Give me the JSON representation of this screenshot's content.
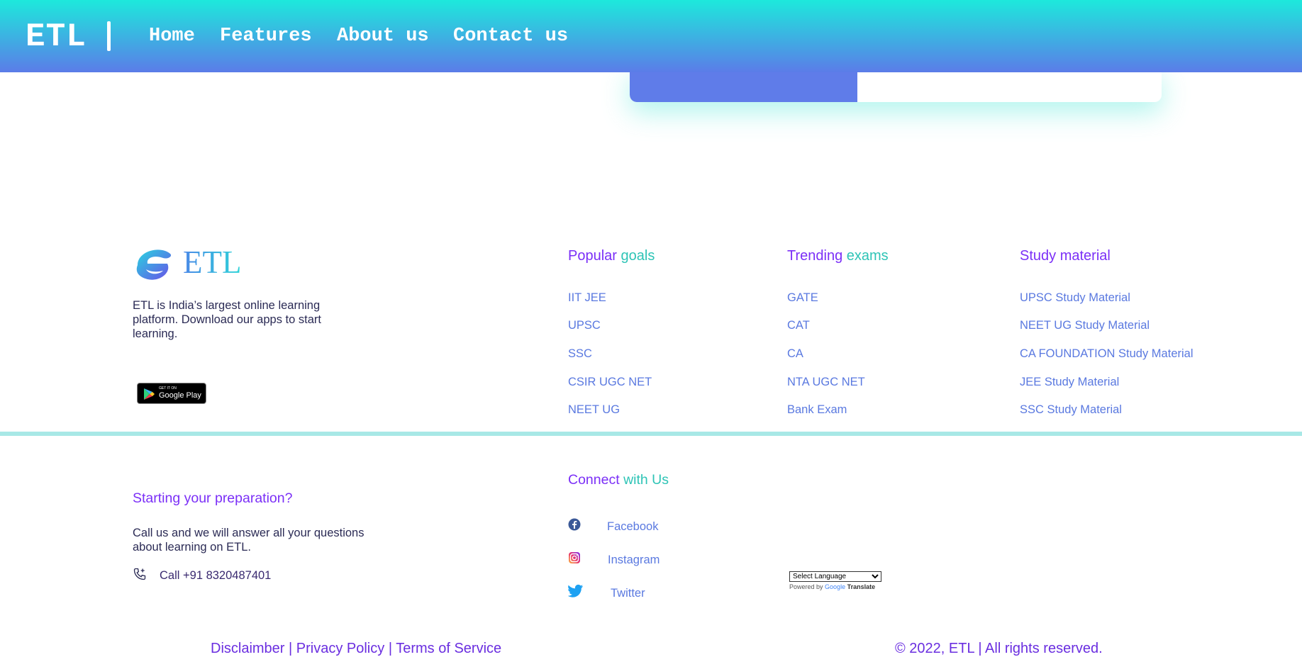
{
  "nav": {
    "brand": "ETL",
    "links": [
      "Home",
      "Features",
      "About us",
      "Contact us"
    ]
  },
  "footer": {
    "logo_text": "ETL",
    "about": "ETL is India’s largest online learning platform. Download our apps to start learning.",
    "google_play": {
      "small": "GET IT ON",
      "big": "Google Play"
    },
    "columns": [
      {
        "heading_a": "Popular ",
        "heading_b": "goals",
        "links": [
          "IIT JEE",
          "UPSC",
          "SSC",
          "CSIR UGC NET",
          "NEET UG"
        ]
      },
      {
        "heading_a": "Trending ",
        "heading_b": "exams",
        "links": [
          "GATE",
          "CAT",
          "CA",
          "NTA UGC NET",
          "Bank Exam"
        ]
      },
      {
        "heading_a": "Study material",
        "heading_b": "",
        "links": [
          "UPSC Study Material",
          "NEET UG Study Material",
          "CA FOUNDATION Study Material",
          "JEE Study Material",
          "SSC Study Material"
        ]
      }
    ],
    "start": {
      "heading": "Starting your preparation?",
      "text": "Call us and we will answer all your questions about learning on ETL.",
      "call": "Call +91 8320487401"
    },
    "connect": {
      "heading_a": "Connect ",
      "heading_b": "with Us",
      "socials": [
        "Facebook",
        "Instagram",
        "Twitter"
      ]
    },
    "translate": {
      "select_label": "Select Language",
      "powered_by": "Powered by",
      "google": "Google",
      "translate": "Translate"
    },
    "bottom": {
      "disclaimer": "Disclaimber",
      "sep": " | ",
      "privacy": "Privacy Policy",
      "terms": "Terms of Service",
      "copyright": "© 2022, ETL | All rights reserved."
    }
  },
  "colors": {
    "nav_top": "#1de9dc",
    "nav_bottom": "#5b7ce8",
    "accent_purple": "#7b2ff7",
    "accent_teal": "#2ec4b6",
    "link_blue": "#5a79e0"
  }
}
